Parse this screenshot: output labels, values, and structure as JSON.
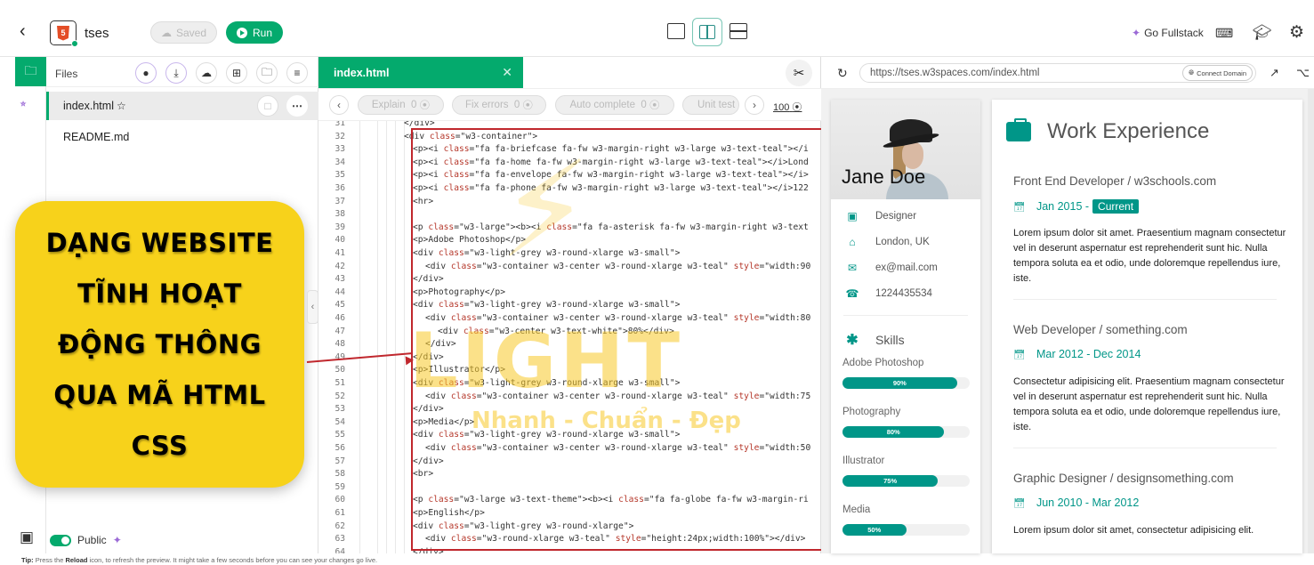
{
  "topbar": {
    "back_icon": "chevron-left-icon",
    "project_icon": "html5-icon",
    "project_name": "tses",
    "saved_label": "Saved",
    "run_label": "Run",
    "layouts": [
      "single-pane",
      "split-vertical",
      "split-horizontal"
    ],
    "active_layout": "split-vertical",
    "go_fullstack_label": "Go Fullstack",
    "icons": [
      "keyboard-icon",
      "graduation-cap-icon",
      "gear-icon"
    ]
  },
  "rail": {
    "items": [
      "folder-icon",
      "robot-icon"
    ],
    "bottom_icon": "chip-icon"
  },
  "files": {
    "title": "Files",
    "header_buttons": [
      "github-icon",
      "download-icon",
      "cloud-upload-icon",
      "new-file-icon",
      "new-folder-icon",
      "filter-icon"
    ],
    "items": [
      {
        "name": "index.html",
        "active": true,
        "starred": false
      },
      {
        "name": "README.md",
        "active": false
      }
    ],
    "public_label": "Public",
    "public_enabled": true
  },
  "overlay": {
    "lines": [
      "DẠNG WEBSITE",
      "TĨNH HOẠT",
      "ĐỘNG THÔNG",
      "QUA MÃ HTML",
      "CSS"
    ],
    "watermark_main": "LIGHT",
    "watermark_sub": "Nhanh - Chuẩn - Đẹp"
  },
  "editor": {
    "tab_label": "index.html",
    "ai_buttons": [
      {
        "label": "Explain",
        "count": "0"
      },
      {
        "label": "Fix errors",
        "count": "0"
      },
      {
        "label": "Auto complete",
        "count": "0"
      },
      {
        "label": "Unit test",
        "count": ""
      }
    ],
    "credits": "100",
    "lines": [
      {
        "n": "31",
        "indent": 0,
        "code": "</div>"
      },
      {
        "n": "32",
        "indent": 0,
        "code": "<div class=\"w3-container\">"
      },
      {
        "n": "33",
        "indent": 1,
        "code": "<p><i class=\"fa fa-briefcase fa-fw w3-margin-right w3-large w3-text-teal\"></i"
      },
      {
        "n": "34",
        "indent": 1,
        "code": "<p><i class=\"fa fa-home fa-fw w3-margin-right w3-large w3-text-teal\"></i>Lond"
      },
      {
        "n": "35",
        "indent": 1,
        "code": "<p><i class=\"fa fa-envelope fa-fw w3-margin-right w3-large w3-text-teal\"></i>"
      },
      {
        "n": "36",
        "indent": 1,
        "code": "<p><i class=\"fa fa-phone fa-fw w3-margin-right w3-large w3-text-teal\"></i>122"
      },
      {
        "n": "37",
        "indent": 1,
        "code": "<hr>"
      },
      {
        "n": "38",
        "indent": 1,
        "code": ""
      },
      {
        "n": "39",
        "indent": 1,
        "code": "<p class=\"w3-large\"><b><i class=\"fa fa-asterisk fa-fw w3-margin-right w3-text"
      },
      {
        "n": "40",
        "indent": 1,
        "code": "<p>Adobe Photoshop</p>"
      },
      {
        "n": "41",
        "indent": 1,
        "code": "<div class=\"w3-light-grey w3-round-xlarge w3-small\">"
      },
      {
        "n": "42",
        "indent": 2,
        "code": "<div class=\"w3-container w3-center w3-round-xlarge w3-teal\" style=\"width:90"
      },
      {
        "n": "43",
        "indent": 1,
        "code": "</div>"
      },
      {
        "n": "44",
        "indent": 1,
        "code": "<p>Photography</p>"
      },
      {
        "n": "45",
        "indent": 1,
        "code": "<div class=\"w3-light-grey w3-round-xlarge w3-small\">"
      },
      {
        "n": "46",
        "indent": 2,
        "code": "<div class=\"w3-container w3-center w3-round-xlarge w3-teal\" style=\"width:80"
      },
      {
        "n": "47",
        "indent": 3,
        "code": "<div class=\"w3-center w3-text-white\">80%</div>"
      },
      {
        "n": "48",
        "indent": 2,
        "code": "</div>"
      },
      {
        "n": "49",
        "indent": 1,
        "code": "</div>"
      },
      {
        "n": "50",
        "indent": 1,
        "code": "<p>Illustrator</p>"
      },
      {
        "n": "51",
        "indent": 1,
        "code": "<div class=\"w3-light-grey w3-round-xlarge w3-small\">"
      },
      {
        "n": "52",
        "indent": 2,
        "code": "<div class=\"w3-container w3-center w3-round-xlarge w3-teal\" style=\"width:75"
      },
      {
        "n": "53",
        "indent": 1,
        "code": "</div>"
      },
      {
        "n": "54",
        "indent": 1,
        "code": "<p>Media</p>"
      },
      {
        "n": "55",
        "indent": 1,
        "code": "<div class=\"w3-light-grey w3-round-xlarge w3-small\">"
      },
      {
        "n": "56",
        "indent": 2,
        "code": "<div class=\"w3-container w3-center w3-round-xlarge w3-teal\" style=\"width:50"
      },
      {
        "n": "57",
        "indent": 1,
        "code": "</div>"
      },
      {
        "n": "58",
        "indent": 1,
        "code": "<br>"
      },
      {
        "n": "59",
        "indent": 1,
        "code": ""
      },
      {
        "n": "60",
        "indent": 1,
        "code": "<p class=\"w3-large w3-text-theme\"><b><i class=\"fa fa-globe fa-fw w3-margin-ri"
      },
      {
        "n": "61",
        "indent": 1,
        "code": "<p>English</p>"
      },
      {
        "n": "62",
        "indent": 1,
        "code": "<div class=\"w3-light-grey w3-round-xlarge\">"
      },
      {
        "n": "63",
        "indent": 2,
        "code": "<div class=\"w3-round-xlarge w3-teal\" style=\"height:24px;width:100%\"></div>"
      },
      {
        "n": "64",
        "indent": 1,
        "code": "</div>"
      }
    ]
  },
  "preview": {
    "url": "https://tses.w3spaces.com/index.html",
    "connect_domain_label": "Connect Domain",
    "profile": {
      "name": "Jane Doe",
      "info": [
        {
          "icon": "briefcase-icon",
          "text": "Designer"
        },
        {
          "icon": "home-icon",
          "text": "London, UK"
        },
        {
          "icon": "envelope-icon",
          "text": "ex@mail.com"
        },
        {
          "icon": "phone-icon",
          "text": "1224435534"
        }
      ],
      "skills_title": "Skills",
      "skills": [
        {
          "name": "Adobe Photoshop",
          "percent": 90,
          "label": "90%"
        },
        {
          "name": "Photography",
          "percent": 80,
          "label": "80%"
        },
        {
          "name": "Illustrator",
          "percent": 75,
          "label": "75%"
        },
        {
          "name": "Media",
          "percent": 50,
          "label": "50%"
        }
      ]
    },
    "work": {
      "title": "Work Experience",
      "jobs": [
        {
          "title": "Front End Developer / w3schools.com",
          "date": "Jan 2015 -",
          "badge": "Current",
          "desc": "Lorem ipsum dolor sit amet. Praesentium magnam consectetur vel in deserunt aspernatur est reprehenderit sunt hic. Nulla tempora soluta ea et odio, unde doloremque repellendus iure, iste."
        },
        {
          "title": "Web Developer / something.com",
          "date": "Mar 2012 - Dec 2014",
          "badge": "",
          "desc": "Consectetur adipisicing elit. Praesentium magnam consectetur vel in deserunt aspernatur est reprehenderit sunt hic. Nulla tempora soluta ea et odio, unde doloremque repellendus iure, iste."
        },
        {
          "title": "Graphic Designer / designsomething.com",
          "date": "Jun 2010 - Mar 2012",
          "badge": "",
          "desc": "Lorem ipsum dolor sit amet, consectetur adipisicing elit."
        }
      ]
    }
  },
  "tip": {
    "prefix": "Tip:",
    "text1": " Press the ",
    "bold": "Reload",
    "text2": " icon, to refresh the preview. It might take a few seconds before you can see your changes go live."
  }
}
